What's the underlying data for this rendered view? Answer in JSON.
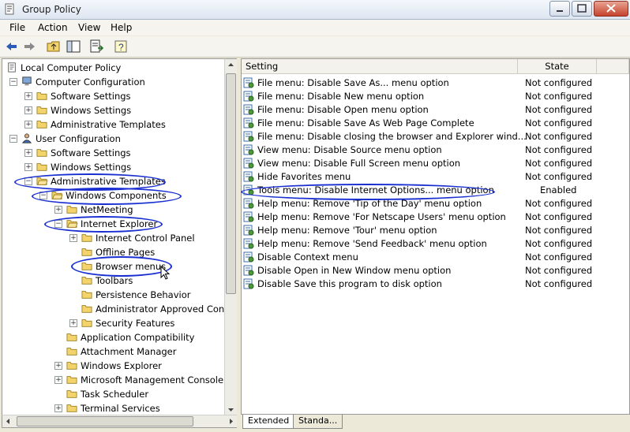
{
  "window": {
    "title": "Group Policy"
  },
  "menubar": [
    "File",
    "Action",
    "View",
    "Help"
  ],
  "toolbar": {
    "icons": [
      "back-arrow-icon",
      "forward-arrow-icon",
      "up-folder-icon",
      "show-hide-tree-icon",
      "export-list-icon",
      "help-icon"
    ]
  },
  "tree": [
    {
      "label": "Local Computer Policy",
      "level": 0,
      "icon": "policy-icon"
    },
    {
      "label": "Computer Configuration",
      "level": 1,
      "expander": "-",
      "icon": "computer-icon"
    },
    {
      "label": "Software Settings",
      "level": 2,
      "expander": "+",
      "icon": "folder-icon"
    },
    {
      "label": "Windows Settings",
      "level": 2,
      "expander": "+",
      "icon": "folder-icon"
    },
    {
      "label": "Administrative Templates",
      "level": 2,
      "expander": "+",
      "icon": "folder-icon"
    },
    {
      "label": "User Configuration",
      "level": 1,
      "expander": "-",
      "icon": "user-icon"
    },
    {
      "label": "Software Settings",
      "level": 2,
      "expander": "+",
      "icon": "folder-icon"
    },
    {
      "label": "Windows Settings",
      "level": 2,
      "expander": "+",
      "icon": "folder-icon"
    },
    {
      "label": "Administrative Templates",
      "level": 2,
      "expander": "-",
      "icon": "folder-open-icon"
    },
    {
      "label": "Windows Components",
      "level": 3,
      "expander": "-",
      "icon": "folder-open-icon"
    },
    {
      "label": "NetMeeting",
      "level": 4,
      "expander": "+",
      "icon": "folder-icon"
    },
    {
      "label": "Internet Explorer",
      "level": 4,
      "expander": "-",
      "icon": "folder-open-icon"
    },
    {
      "label": "Internet Control Panel",
      "level": 5,
      "expander": "+",
      "icon": "folder-icon"
    },
    {
      "label": "Offline Pages",
      "level": 5,
      "icon": "folder-icon"
    },
    {
      "label": "Browser menus",
      "level": 5,
      "icon": "folder-icon",
      "selected": true
    },
    {
      "label": "Toolbars",
      "level": 5,
      "icon": "folder-icon"
    },
    {
      "label": "Persistence Behavior",
      "level": 5,
      "icon": "folder-icon"
    },
    {
      "label": "Administrator Approved Cont",
      "level": 5,
      "icon": "folder-icon"
    },
    {
      "label": "Security Features",
      "level": 5,
      "expander": "+",
      "icon": "folder-icon"
    },
    {
      "label": "Application Compatibility",
      "level": 4,
      "icon": "folder-icon"
    },
    {
      "label": "Attachment Manager",
      "level": 4,
      "icon": "folder-icon"
    },
    {
      "label": "Windows Explorer",
      "level": 4,
      "expander": "+",
      "icon": "folder-icon"
    },
    {
      "label": "Microsoft Management Console",
      "level": 4,
      "expander": "+",
      "icon": "folder-icon"
    },
    {
      "label": "Task Scheduler",
      "level": 4,
      "icon": "folder-icon"
    },
    {
      "label": "Terminal Services",
      "level": 4,
      "expander": "+",
      "icon": "folder-icon"
    }
  ],
  "list": {
    "columns": [
      "Setting",
      "State"
    ],
    "rows": [
      {
        "setting": "File menu: Disable Save As... menu option",
        "state": "Not configured"
      },
      {
        "setting": "File menu: Disable New menu option",
        "state": "Not configured"
      },
      {
        "setting": "File menu: Disable Open menu option",
        "state": "Not configured"
      },
      {
        "setting": "File menu: Disable Save As Web Page Complete",
        "state": "Not configured"
      },
      {
        "setting": "File menu: Disable closing the browser and Explorer wind...",
        "state": "Not configured"
      },
      {
        "setting": "View menu: Disable Source menu option",
        "state": "Not configured"
      },
      {
        "setting": "View menu: Disable Full Screen menu option",
        "state": "Not configured"
      },
      {
        "setting": "Hide Favorites menu",
        "state": "Not configured"
      },
      {
        "setting": "Tools menu: Disable Internet Options... menu option",
        "state": "Enabled"
      },
      {
        "setting": "Help menu: Remove 'Tip of the Day' menu option",
        "state": "Not configured"
      },
      {
        "setting": "Help menu: Remove 'For Netscape Users' menu option",
        "state": "Not configured"
      },
      {
        "setting": "Help menu: Remove 'Tour' menu option",
        "state": "Not configured"
      },
      {
        "setting": "Help menu: Remove 'Send Feedback' menu option",
        "state": "Not configured"
      },
      {
        "setting": "Disable Context menu",
        "state": "Not configured"
      },
      {
        "setting": "Disable Open in New Window menu option",
        "state": "Not configured"
      },
      {
        "setting": "Disable Save this program to disk option",
        "state": "Not configured"
      }
    ]
  },
  "tabs": [
    {
      "label": "Extended",
      "active": true
    },
    {
      "label": "Standa...",
      "active": false
    }
  ],
  "colors": {
    "annotation": "#1a2fd1",
    "folder": "#f3d36b"
  }
}
